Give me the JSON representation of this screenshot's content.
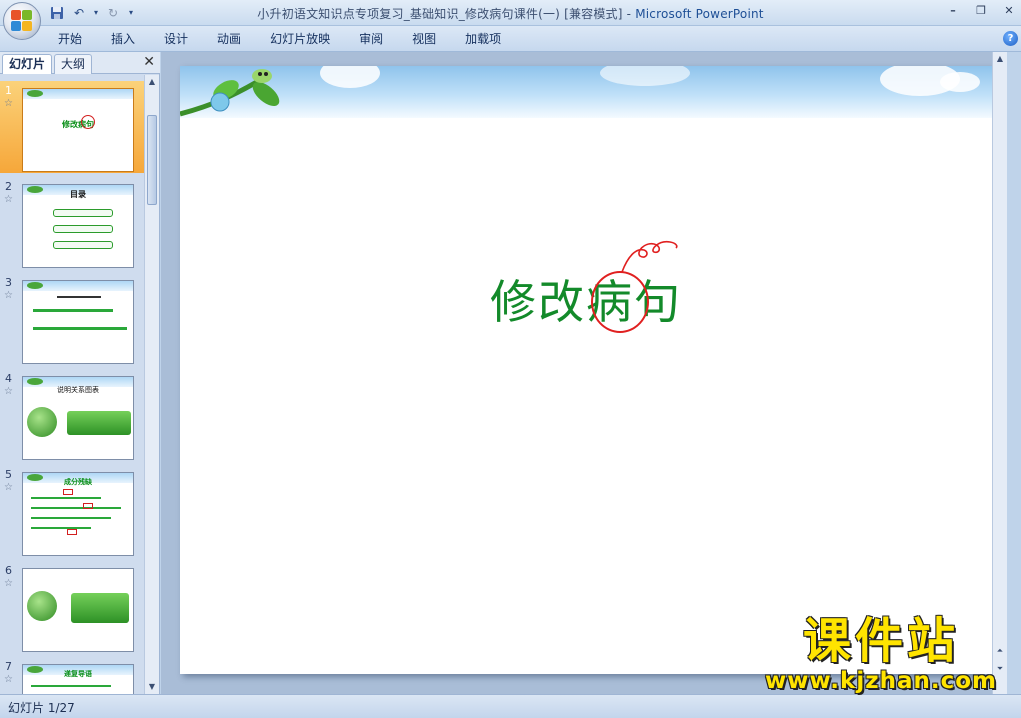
{
  "window": {
    "title_doc": "小升初语文知识点专项复习_基础知识_修改病句课件(一) [兼容模式]",
    "title_sep": " - ",
    "title_app": "Microsoft PowerPoint"
  },
  "ribbon": {
    "tabs": [
      "开始",
      "插入",
      "设计",
      "动画",
      "幻灯片放映",
      "审阅",
      "视图",
      "加载项"
    ]
  },
  "left_panel": {
    "tabs": [
      "幻灯片",
      "大纲"
    ],
    "active_tab": "幻灯片",
    "thumbnails": [
      {
        "num": "1",
        "selected": true,
        "title": "修改病句"
      },
      {
        "num": "2",
        "title": "目录"
      },
      {
        "num": "3"
      },
      {
        "num": "4",
        "title": "说明关系图表"
      },
      {
        "num": "5",
        "title": "成分残缺"
      },
      {
        "num": "6"
      },
      {
        "num": "7",
        "title": "递复导语"
      }
    ]
  },
  "slide": {
    "title": "修改病句"
  },
  "status": {
    "slide_indicator": "幻灯片 1/27"
  },
  "watermark": {
    "title": "课件站",
    "url": "www.kjzhan.com"
  },
  "colors": {
    "title_green": "#138a2a",
    "accent_red": "#e02020",
    "selection_orange": "#f6a73a"
  }
}
